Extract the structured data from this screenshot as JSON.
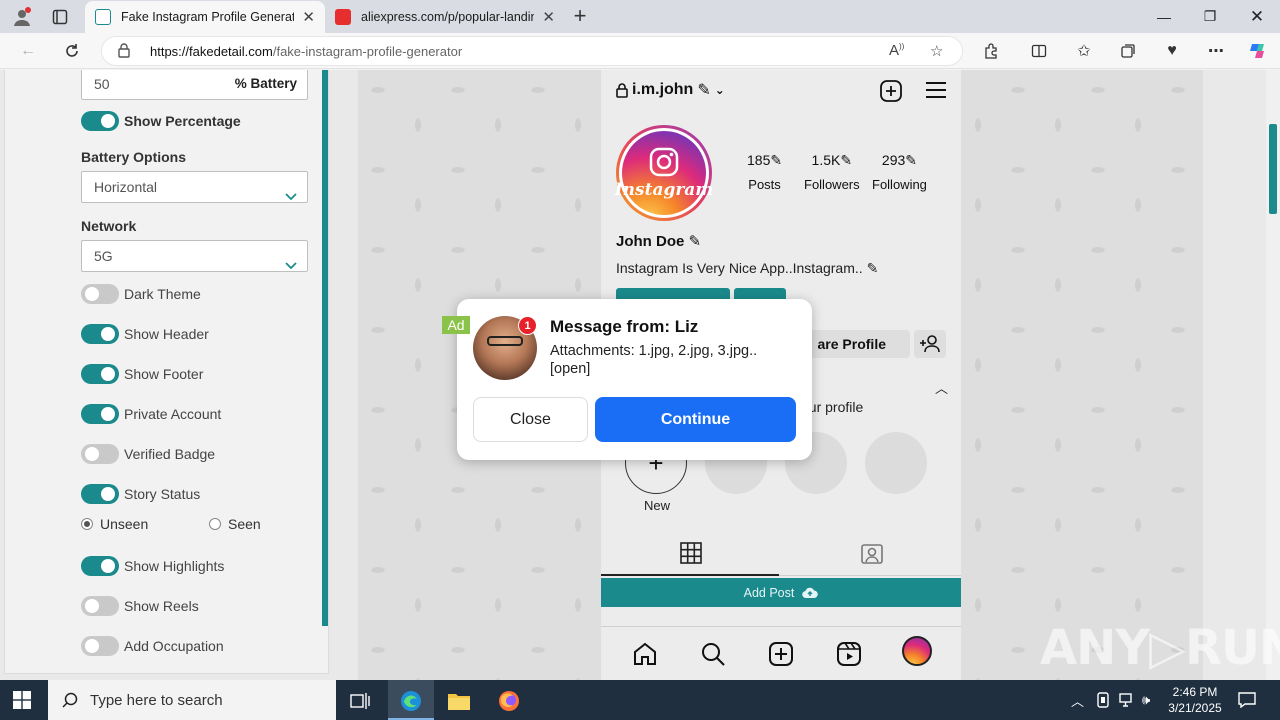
{
  "browser": {
    "tabs": [
      {
        "title": "Fake Instagram Profile Generator",
        "active": true
      },
      {
        "title": "aliexpress.com/p/popular-landin",
        "active": false
      }
    ],
    "url_domain": "https://fakedetail.com",
    "url_path": "/fake-instagram-profile-generator"
  },
  "settings": {
    "battery_value": "50",
    "battery_suffix": "% Battery",
    "show_percentage": "Show Percentage",
    "battery_options_label": "Battery Options",
    "battery_options_value": "Horizontal",
    "network_label": "Network",
    "network_value": "5G",
    "toggles": [
      {
        "label": "Dark Theme",
        "on": false
      },
      {
        "label": "Show Header",
        "on": true
      },
      {
        "label": "Show Footer",
        "on": true
      },
      {
        "label": "Private Account",
        "on": true
      },
      {
        "label": "Verified Badge",
        "on": false
      },
      {
        "label": "Story Status",
        "on": true
      }
    ],
    "story_radio": {
      "unseen": "Unseen",
      "seen": "Seen"
    },
    "toggles2": [
      {
        "label": "Show Highlights",
        "on": true
      },
      {
        "label": "Show Reels",
        "on": false
      },
      {
        "label": "Add Occupation",
        "on": false
      }
    ]
  },
  "profile": {
    "username": "i.m.john",
    "avatar_word": "Instagram",
    "posts_count": "185",
    "posts_label": "Posts",
    "followers_count": "1.5K",
    "followers_label": "Followers",
    "following_count": "293",
    "following_label": "Following",
    "name": "John Doe",
    "bio": "Instagram Is Very Nice App..Instagram..",
    "share_profile_partial": "are Profile",
    "your_profile_partial": "our profile",
    "new_label": "New",
    "add_post": "Add Post"
  },
  "ad": {
    "badge": "Ad",
    "notif_count": "1",
    "title": "Message from: Liz",
    "text": "Attachments: 1.jpg, 2.jpg, 3.jpg..\n[open]",
    "close": "Close",
    "continue": "Continue"
  },
  "watermark": "ANY▷RUN",
  "taskbar": {
    "search_placeholder": "Type here to search",
    "time": "2:46 PM",
    "date": "3/21/2025"
  },
  "colors": {
    "teal": "#1b8a8c",
    "continue_blue": "#1a6ef5",
    "ad_green": "#8bc34a"
  }
}
